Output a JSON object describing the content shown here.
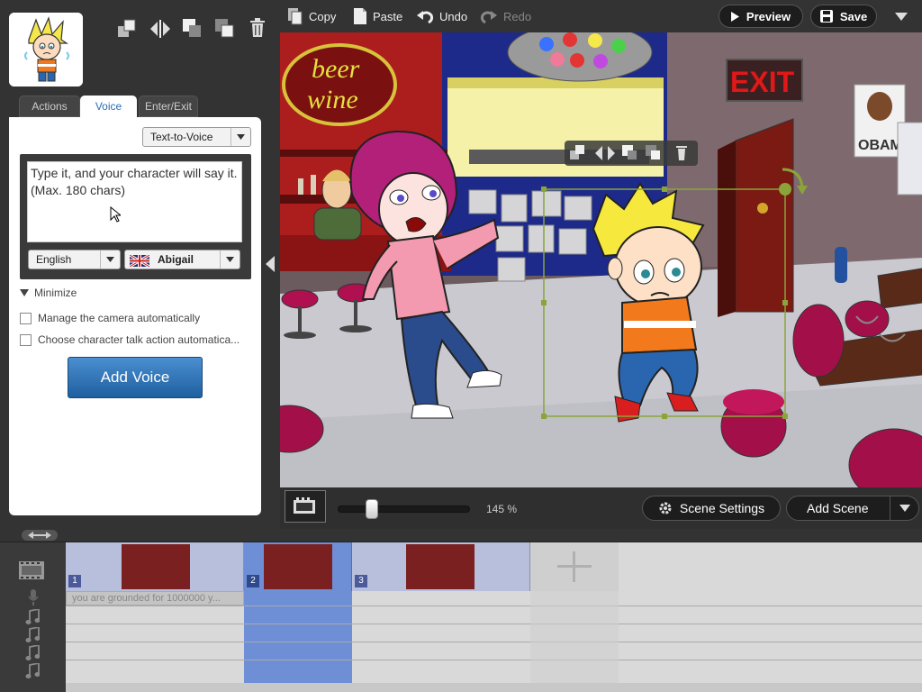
{
  "toolbar": {
    "copy_label": "Copy",
    "paste_label": "Paste",
    "undo_label": "Undo",
    "redo_label": "Redo",
    "preview_label": "Preview",
    "save_label": "Save"
  },
  "left_panel": {
    "tabs": [
      {
        "label": "Actions"
      },
      {
        "label": "Voice",
        "active": true
      },
      {
        "label": "Enter/Exit"
      }
    ],
    "voice_mode": "Text-to-Voice",
    "text_input_value": "Type it, and your character will say it.  (Max.  180 chars)",
    "language": "English",
    "voice_name": "Abigail",
    "minimize_label": "Minimize",
    "checkboxes": [
      {
        "label": "Manage the camera automatically",
        "checked": false
      },
      {
        "label": "Choose character talk action automatica...",
        "checked": false
      }
    ],
    "add_voice_label": "Add Voice"
  },
  "stage": {
    "sign_beer": "beer",
    "sign_wine": "wine",
    "exit_sign": "EXIT",
    "poster_text": "OBAMA"
  },
  "stage_bar": {
    "zoom_label": "145 %",
    "zoom_value": 145,
    "scene_settings_label": "Scene Settings",
    "add_scene_label": "Add Scene"
  },
  "timeline": {
    "scenes": [
      {
        "number": "1"
      },
      {
        "number": "2",
        "selected": true
      },
      {
        "number": "3"
      }
    ],
    "dialogue_text": "you are grounded for 1000000 y..."
  },
  "colors": {
    "accent_blue": "#2a6cb5",
    "selection_green": "#8aa43a",
    "timeline_selected": "#6e8fd6",
    "timeline_scene": "#b7bfdc"
  }
}
